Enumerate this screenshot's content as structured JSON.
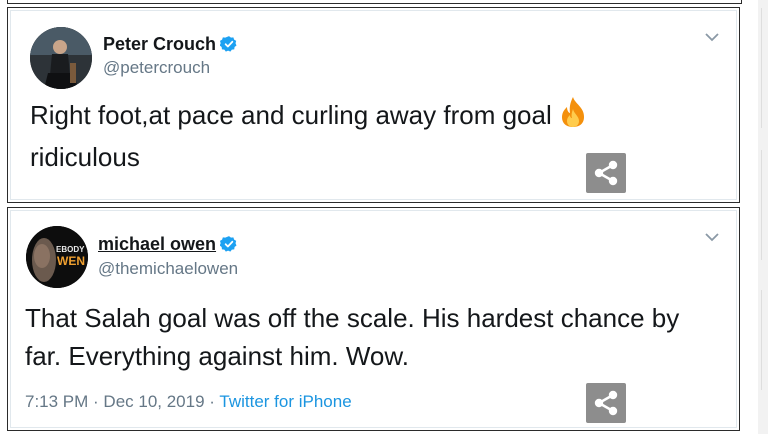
{
  "tweets": [
    {
      "author": "Peter Crouch",
      "handle": "@petercrouch",
      "line1": "Right foot,at pace and curling away from goal",
      "line2": "ridiculous",
      "emoji_icon": "fire-icon"
    },
    {
      "author": "michael owen",
      "handle": "@themichaelowen",
      "line1": "That Salah goal was off the scale. His hardest chance by",
      "line2": "far. Everything against him. Wow.",
      "time": "7:13 PM",
      "sep1": " · ",
      "date": "Dec 10, 2019",
      "sep2": " · ",
      "source": "Twitter for iPhone",
      "avatar_text": [
        "EBODY",
        "WEN"
      ]
    }
  ],
  "colors": {
    "verified": "#1da1f2",
    "link": "#1b95e0",
    "secondary": "#657786",
    "share_bg": "#8d8d8d"
  }
}
